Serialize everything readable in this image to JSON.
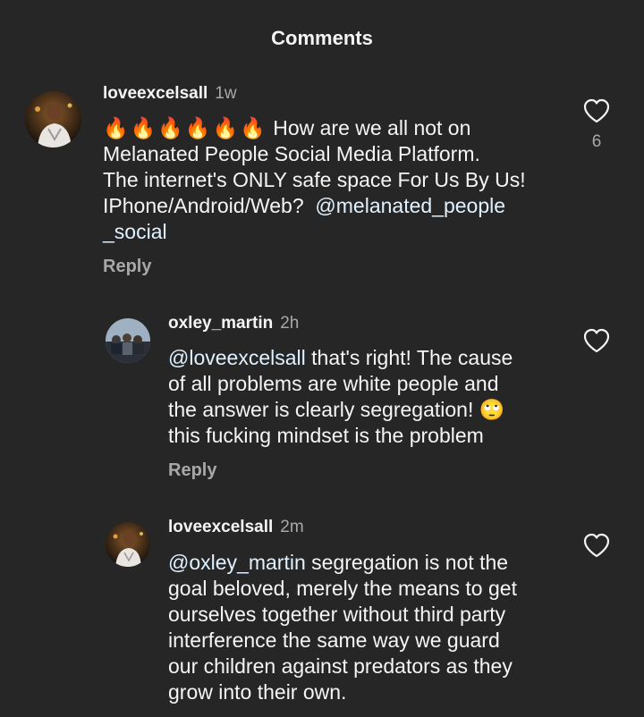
{
  "header": {
    "title": "Comments"
  },
  "comments": [
    {
      "username": "loveexcelsall",
      "time": "1w",
      "emojis": "🔥🔥🔥🔥🔥🔥",
      "text_lines": [
        "How are we all not on",
        "Melanated People Social Media Platform.",
        "The internet's ONLY safe space For Us By Us!",
        "IPhone/Android/Web?"
      ],
      "mention_line_1": "@melanated_people",
      "mention_line_2": "_social",
      "reply_label": "Reply",
      "like_count": "6"
    },
    {
      "username": "oxley_martin",
      "time": "2h",
      "mention": "@loveexcelsall",
      "text_lines": [
        "that's right! The cause",
        "of all problems are white people and",
        "the answer is clearly segregation! 🙄",
        "this fucking mindset is the problem"
      ],
      "reply_label": "Reply"
    },
    {
      "username": "loveexcelsall",
      "time": "2m",
      "mention": "@oxley_martin",
      "text_lines": [
        "segregation is not the",
        "goal beloved, merely the means to get",
        "ourselves together without third party",
        "interference the same way we guard",
        "our children against predators as they",
        "grow into their own."
      ]
    }
  ],
  "colors": {
    "background": "#262626",
    "text": "#f5f5f5",
    "secondary": "#a8a8a8",
    "mention": "#e0f1ff"
  },
  "icons": {
    "like": "heart-outline-icon"
  }
}
